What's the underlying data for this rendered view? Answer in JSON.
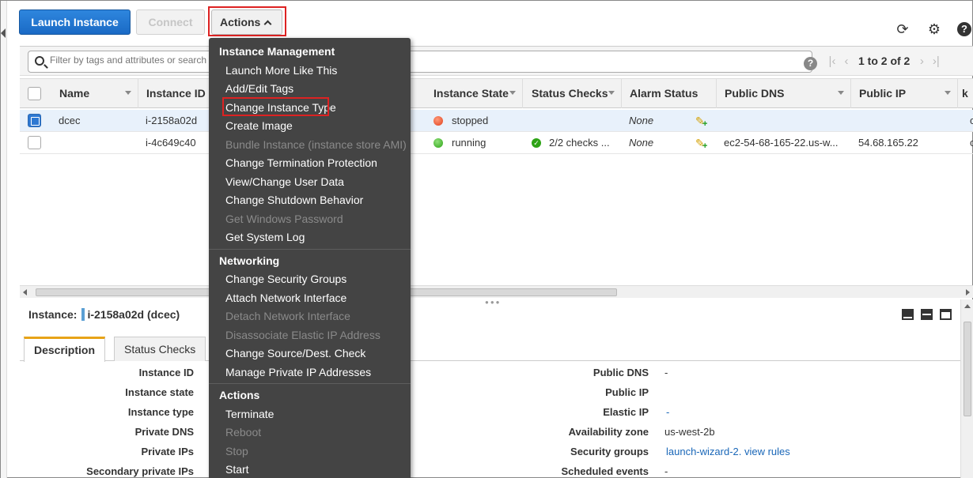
{
  "toolbar": {
    "launch_label": "Launch Instance",
    "connect_label": "Connect",
    "actions_label": "Actions"
  },
  "search": {
    "placeholder": "Filter by tags and attributes or search by keyword",
    "help": "?"
  },
  "pager": {
    "text": "1 to 2 of 2"
  },
  "table": {
    "headers": {
      "name": "Name",
      "instance_id": "Instance ID",
      "instance_state": "Instance State",
      "status_checks": "Status Checks",
      "alarm_status": "Alarm Status",
      "public_dns": "Public DNS",
      "public_ip": "Public IP"
    },
    "rows": [
      {
        "name": "dcec",
        "instance_id": "i-2158a02d",
        "state": "stopped",
        "status_checks": "",
        "alarm": "None",
        "public_dns": "",
        "public_ip": "",
        "selected": true,
        "overflow": "c"
      },
      {
        "name": "",
        "instance_id": "i-4c649c40",
        "state": "running",
        "status_checks": "2/2 checks ...",
        "alarm": "None",
        "public_dns": "ec2-54-68-165-22.us-w...",
        "public_ip": "54.68.165.22",
        "selected": false,
        "overflow": "c"
      }
    ]
  },
  "details": {
    "title_prefix": "Instance:",
    "title_value": "i-2158a02d (dcec)",
    "tabs": [
      "Description",
      "Status Checks"
    ],
    "left_labels": [
      "Instance ID",
      "Instance state",
      "Instance type",
      "Private DNS",
      "Private IPs",
      "Secondary private IPs"
    ],
    "right": [
      {
        "label": "Public DNS",
        "value": "-"
      },
      {
        "label": "Public IP",
        "value": ""
      },
      {
        "label": "Elastic IP",
        "value": "-"
      },
      {
        "label": "Availability zone",
        "value": "us-west-2b"
      },
      {
        "label": "Security groups",
        "value": "launch-wizard-2",
        "extra": ". view rules"
      },
      {
        "label": "Scheduled events",
        "value": "-"
      }
    ]
  },
  "menu": {
    "sections": [
      {
        "heading": "Instance Management",
        "items": [
          {
            "label": "Launch More Like This",
            "disabled": false
          },
          {
            "label": "Add/Edit Tags",
            "disabled": false
          },
          {
            "label": "Change Instance Type",
            "disabled": false
          },
          {
            "label": "Create Image",
            "disabled": false
          },
          {
            "label": "Bundle Instance (instance store AMI)",
            "disabled": true
          },
          {
            "label": "Change Termination Protection",
            "disabled": false
          },
          {
            "label": "View/Change User Data",
            "disabled": false
          },
          {
            "label": "Change Shutdown Behavior",
            "disabled": false
          },
          {
            "label": "Get Windows Password",
            "disabled": true
          },
          {
            "label": "Get System Log",
            "disabled": false
          }
        ]
      },
      {
        "heading": "Networking",
        "items": [
          {
            "label": "Change Security Groups",
            "disabled": false
          },
          {
            "label": "Attach Network Interface",
            "disabled": false
          },
          {
            "label": "Detach Network Interface",
            "disabled": true
          },
          {
            "label": "Disassociate Elastic IP Address",
            "disabled": true
          },
          {
            "label": "Change Source/Dest. Check",
            "disabled": false
          },
          {
            "label": "Manage Private IP Addresses",
            "disabled": false
          }
        ]
      },
      {
        "heading": "Actions",
        "items": [
          {
            "label": "Terminate",
            "disabled": false
          },
          {
            "label": "Reboot",
            "disabled": true
          },
          {
            "label": "Stop",
            "disabled": true
          },
          {
            "label": "Start",
            "disabled": false
          }
        ]
      }
    ]
  },
  "colors": {
    "accent": "#2d78d2",
    "menu_bg": "#444444",
    "highlight": "#dd2222",
    "stopped": "#e0401c",
    "running": "#2ea316"
  },
  "icons": [
    "refresh-icon",
    "gear-icon",
    "help-icon",
    "search-icon"
  ]
}
